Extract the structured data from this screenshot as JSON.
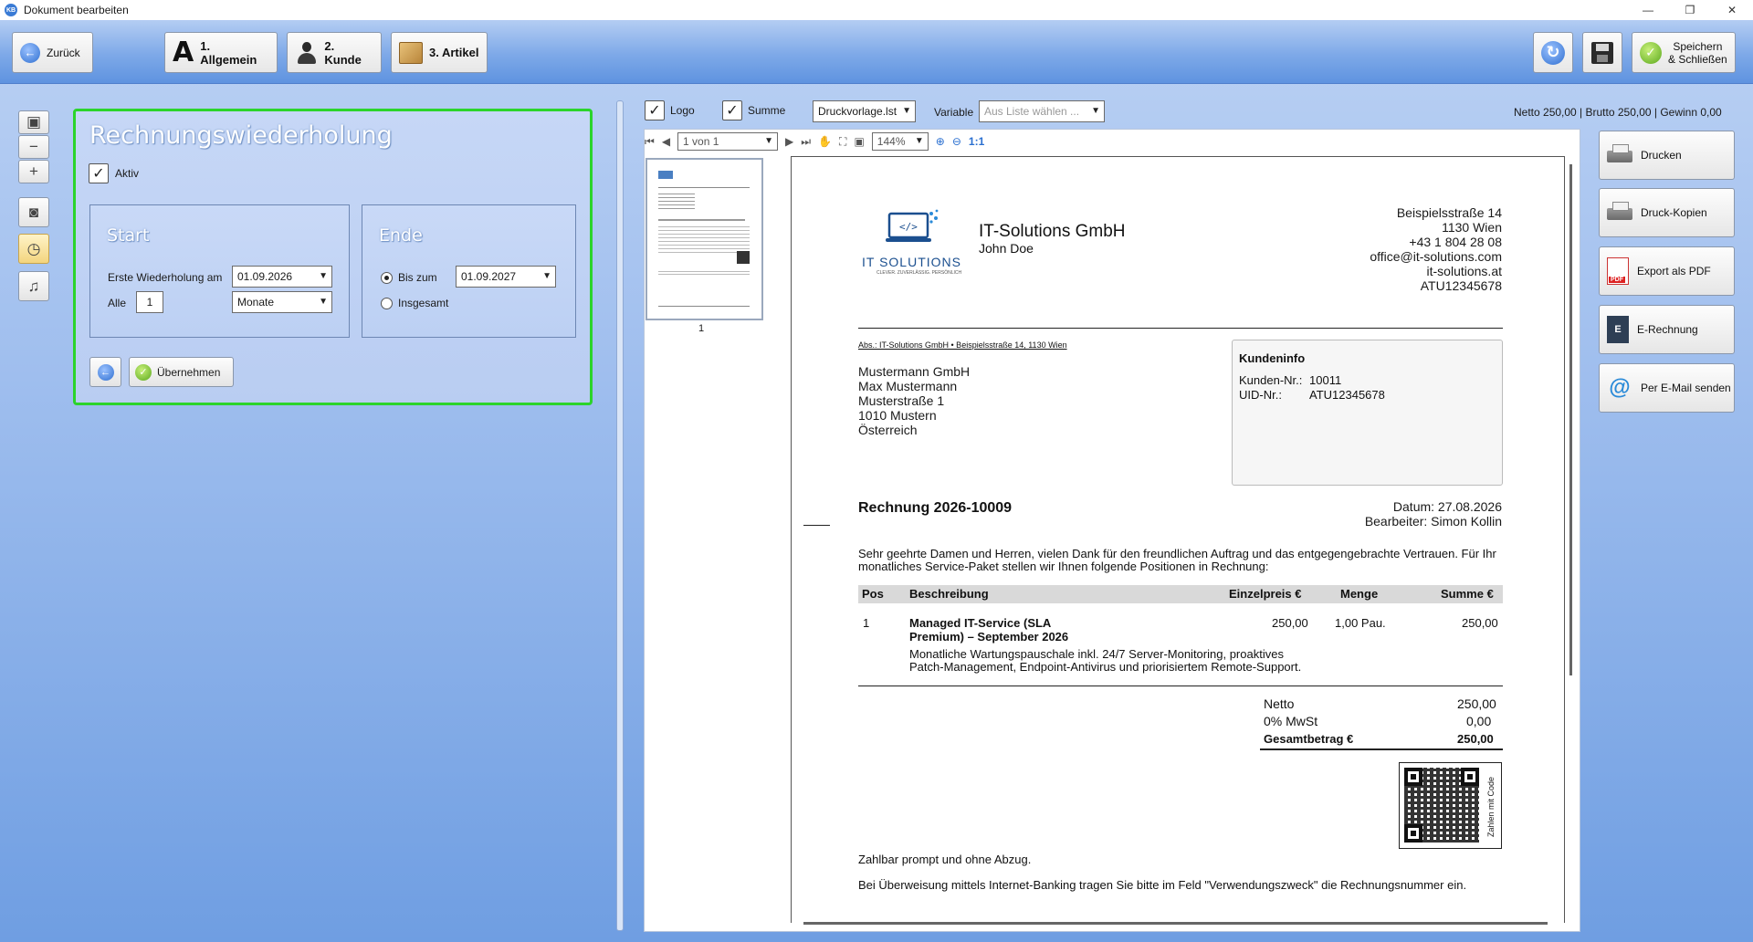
{
  "window": {
    "title": "Dokument bearbeiten",
    "app_icon_text": "KB",
    "minimize": "—",
    "restore": "❐",
    "close": "✕"
  },
  "toolbar": {
    "back_label": "Zurück",
    "general_label": "1. Allgemein",
    "customer_label": "2. Kunde",
    "articles_label": "3. Artikel",
    "save_close_label_1": "Speichern",
    "save_close_label_2": "& Schließen"
  },
  "recurrence": {
    "title": "Rechnungswiederholung",
    "active_label": "Aktiv",
    "active_checked": true,
    "start": {
      "title": "Start",
      "first_repeat_label": "Erste Wiederholung am",
      "first_repeat_value": "01.09.2026",
      "every_label": "Alle",
      "every_value": "1",
      "unit_value": "Monate"
    },
    "end": {
      "title": "Ende",
      "until_label": "Bis zum",
      "until_value": "01.09.2027",
      "total_label": "Insgesamt",
      "selected": "until"
    },
    "apply_label": "Übernehmen"
  },
  "preview_toolbar": {
    "logo_label": "Logo",
    "sum_label": "Summe",
    "template_value": "Druckvorlage.lst",
    "variable_label": "Variable",
    "variable_placeholder": "Aus Liste wählen ...",
    "totals": "Netto 250,00 | Brutto 250,00 | Gewinn 0,00",
    "page_value": "1 von 1",
    "zoom_value": "144%",
    "zoom_1to1": "1:1",
    "thumb_page_number": "1"
  },
  "actions": {
    "print": "Drucken",
    "print_copies": "Druck-Kopien",
    "export_pdf": "Export als PDF",
    "e_invoice": "E-Rechnung",
    "email": "Per E-Mail senden"
  },
  "invoice": {
    "logo_text": "IT SOLUTIONS",
    "logo_tagline": "CLEVER. ZUVERLÄSSIG. PERSÖNLICH",
    "company": "IT-Solutions GmbH",
    "contact": "John Doe",
    "address_lines": [
      "Beispielsstraße 14",
      "1130 Wien",
      "+43 1 804 28 08",
      "office@it-solutions.com",
      "it-solutions.at",
      "ATU12345678"
    ],
    "sender_line": "Abs.: IT-Solutions GmbH • Beispielsstraße 14, 1130 Wien",
    "recipient_lines": [
      "Mustermann GmbH",
      "Max Mustermann",
      "Musterstraße 1",
      "1010 Mustern",
      "Österreich"
    ],
    "customer_info_title": "Kundeninfo",
    "customer_no_label": "Kunden-Nr.:",
    "customer_no": "10011",
    "uid_label": "UID-Nr.:",
    "uid": "ATU12345678",
    "title": "Rechnung 2026-10009",
    "date": "Datum: 27.08.2026",
    "clerk": "Bearbeiter: Simon Kollin",
    "intro_1": "Sehr geehrte Damen und Herren, vielen Dank für den freundlichen Auftrag und das entgegengebrachte Vertrauen. Für Ihr",
    "intro_2": "monatliches Service-Paket stellen wir Ihnen folgende Positionen in Rechnung:",
    "columns": {
      "pos": "Pos",
      "desc": "Beschreibung",
      "unit_price": "Einzelpreis €",
      "qty": "Menge",
      "sum": "Summe €"
    },
    "item": {
      "pos": "1",
      "title_1": "Managed IT-Service (SLA",
      "title_2": "Premium) – September 2026",
      "desc_1": "Monatliche Wartungspauschale inkl. 24/7 Server-Monitoring, proaktives",
      "desc_2": "Patch-Management, Endpoint-Antivirus und priorisiertem Remote-Support.",
      "unit_price": "250,00",
      "qty": "1,00 Pau.",
      "sum": "250,00"
    },
    "net_label": "Netto",
    "net": "250,00",
    "vat_label": "0% MwSt",
    "vat": "0,00",
    "total_label": "Gesamtbetrag €",
    "total": "250,00",
    "qr_caption": "Zahlen mit Code",
    "payment_1": "Zahlbar prompt und ohne Abzug.",
    "payment_2": "Bei Überweisung mittels Internet-Banking tragen Sie bitte im Feld \"Verwendungszweck\" die Rechnungsnummer ein."
  }
}
